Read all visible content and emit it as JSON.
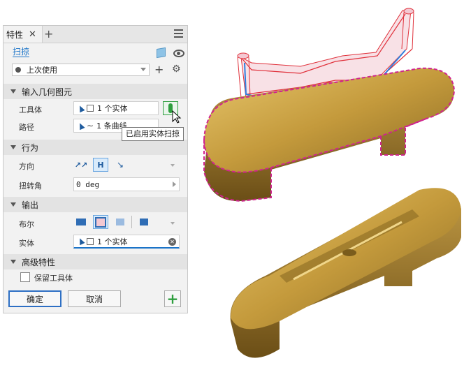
{
  "panel": {
    "tab_title": "特性",
    "command_name": "扫掠",
    "preset": "上次使用"
  },
  "sections": {
    "input_geometry": {
      "title": "输入几何图元",
      "tool_body_label": "工具体",
      "tool_body_value": "1 个实体",
      "path_label": "路径",
      "path_value": "1 条曲线",
      "tooltip": "已启用实体扫掠"
    },
    "behavior": {
      "title": "行为",
      "direction_label": "方向",
      "twist_label": "扭转角",
      "twist_value": "0 deg"
    },
    "output": {
      "title": "输出",
      "boolean_label": "布尔",
      "solid_label": "实体",
      "solid_value": "1 个实体"
    },
    "advanced": {
      "title": "高级特性",
      "keep_tool_label": "保留工具体"
    }
  },
  "buttons": {
    "ok": "确定",
    "cancel": "取消"
  },
  "colors": {
    "accent": "#1a73c8",
    "add_green": "#2e9e3e",
    "bronze": "#a8832b",
    "highlight_magenta": "#d0248f",
    "path_red": "#e0303a"
  }
}
